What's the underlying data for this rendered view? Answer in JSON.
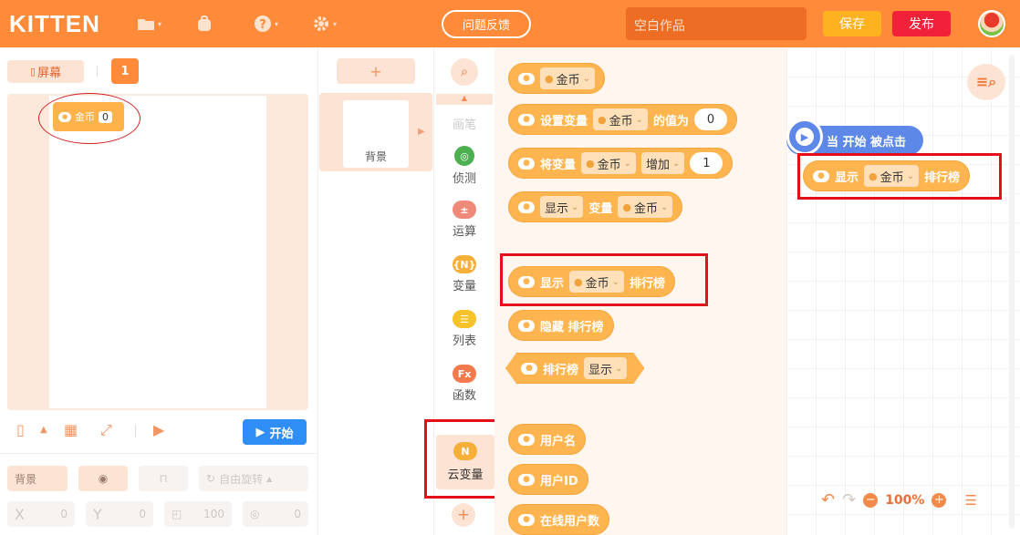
{
  "header": {
    "logo": "KITTEN",
    "feedback": "问题反馈",
    "project_name": "空白作品",
    "save": "保存",
    "publish": "发布"
  },
  "stage": {
    "screen_label": "屏幕",
    "screen_number": "1",
    "monitor_label": "金币",
    "monitor_value": "0",
    "start": "开始"
  },
  "properties": {
    "name": "背景",
    "rotation": "自由旋转",
    "x_label": "X",
    "x_value": "0",
    "y_label": "Y",
    "y_value": "0",
    "size_value": "100",
    "direction_value": "0"
  },
  "sprites": {
    "add": "+",
    "background_label": "背景"
  },
  "categories": {
    "pen": "画笔",
    "detect": "侦测",
    "math": "运算",
    "variable": "变量",
    "list": "列表",
    "function": "函数",
    "cloud_variable": "云变量",
    "add": "+"
  },
  "blocks": {
    "var_name": "金币",
    "set_var": "设置变量",
    "value_of": "的值为",
    "set_value": "0",
    "change_var": "将变量",
    "increase": "增加",
    "change_value": "1",
    "show": "显示",
    "variable": "变量",
    "leaderboard": "排行榜",
    "hide_leaderboard": "隐藏 排行榜",
    "leaderboard_reporter": "排行榜",
    "reporter_option": "显示",
    "username": "用户名",
    "user_id": "用户ID",
    "online_users": "在线用户数"
  },
  "workspace": {
    "hat_label": "当 开始 被点击",
    "zoom": "100%"
  },
  "colors": {
    "brand_orange": "#fe8a3a",
    "cloud_block": "#ffb54f",
    "event_block": "#5e88e8",
    "highlight": "#e30f1a"
  }
}
